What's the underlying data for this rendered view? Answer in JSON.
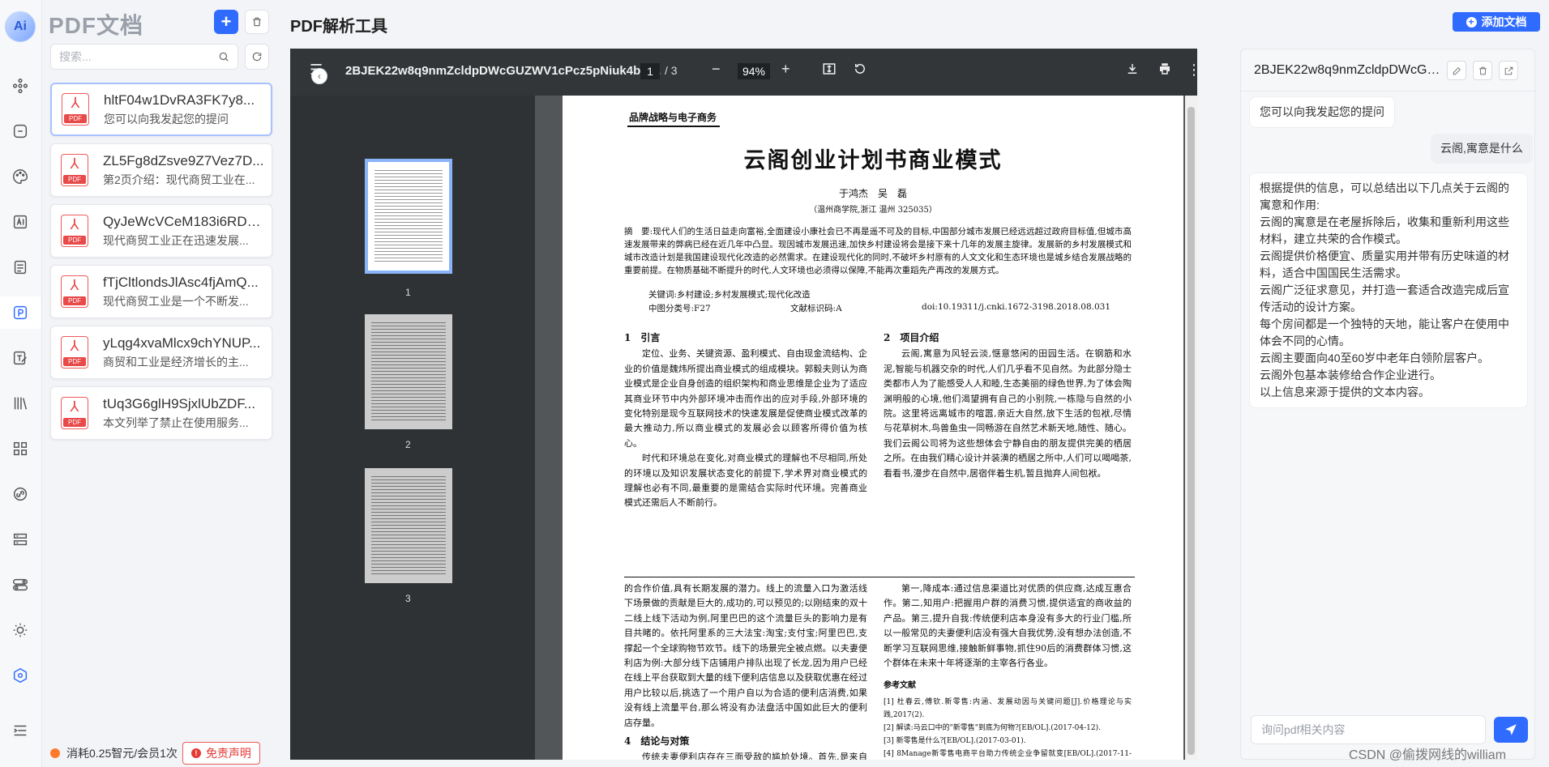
{
  "rail": {
    "logo_text": "Ai"
  },
  "doclist": {
    "title": "PDF文档",
    "search_placeholder": "搜索...",
    "items": [
      {
        "name": "hltF04w1DvRA3FK7y8...",
        "desc": "您可以向我发起您的提问"
      },
      {
        "name": "ZL5Fg8dZsve9Z7Vez7D...",
        "desc": "第2页介绍：现代商贸工业在..."
      },
      {
        "name": "QyJeWcVCeM183i6RD4...",
        "desc": "现代商贸工业正在迅速发展..."
      },
      {
        "name": "fTjCltlondsJlAsc4fjAmQ...",
        "desc": "现代商贸工业是一个不断发..."
      },
      {
        "name": "yLqg4xvaMlcx9chYNUP...",
        "desc": "商贸和工业是经济增长的主..."
      },
      {
        "name": "tUq3G6glH9SjxlUbZDF...",
        "desc": "本文列举了禁止在使用服务..."
      }
    ],
    "footer_text": "消耗0.25智元/会员1次",
    "disclaimer_label": "免责声明",
    "pdf_tag": "PDF"
  },
  "main": {
    "title": "PDF解析工具",
    "add_doc_label": "添加文档"
  },
  "viewer": {
    "file_name": "2BJEK22w8q9nmZcldpDWcGUZWV1cPcz5pNiuk4b4....",
    "page_current": "1",
    "page_total": "/  3",
    "zoom": "94%",
    "thumbnails": [
      "1",
      "2",
      "3"
    ]
  },
  "paper": {
    "section_tag": "品牌战略与电子商务",
    "title": "云阁创业计划书商业模式",
    "authors": "于鸿杰　吴　磊",
    "affiliation": "（温州商学院,浙江 温州 325035）",
    "abstract": "摘　要:现代人们的生活日益走向富裕,全面建设小康社会已不再是遥不可及的目标,中国部分城市发展已经远远超过政府目标值,但城市高速发展带来的弊病已经在近几年中凸显。现因城市发展迅速,加快乡村建设将会是接下来十几年的发展主旋律。发展新的乡村发展模式和城市改造计划是我国建设现代化改造的必然需求。在建设现代化的同时,不破坏乡村原有的人文文化和生态环境也是城乡结合发展战略的重要前提。在物质基础不断提升的时代,人文环境也必须得以保障,不能再次重蹈先产再改的发展方式。",
    "keywords": "关键词:乡村建设;乡村发展模式;现代化改造",
    "class_no": "中图分类号:F27",
    "doc_code": "文献标识码:A",
    "doi": "doi:10.19311/j.cnki.1672-3198.2018.08.031",
    "s1_title": "1　引言",
    "s1_p1": "定位、业务、关键资源、盈利模式、自由现金流结构、企业的价值是魏炜所提出商业模式的组成模块。郭毅夫则认为商业模式是企业自身创造的组织架构和商业思维是企业为了适应其商业环节中内外部环境冲击而作出的应对手段,外部环境的变化特别是现今互联网技术的快速发展是促使商业模式改革的最大推动力,所以商业模式的发展必会以顾客所得价值为核心。",
    "s1_p2": "时代和环境总在变化,对商业模式的理解也不尽相同,所处的环境以及知识发展状态变化的前提下,学术界对商业模式的理解也必有不同,最重要的是需结合实际时代环境。完善商业模式还需后人不断前行。",
    "s2_title": "2　项目介绍",
    "s2_p1": "云阁,寓意为风轻云淡,惬意悠闲的田园生活。在钢筋和水泥,智能与机器交杂的时代,人们几乎看不见自然。为此部分隐士类都市人为了能感受人人和睦,生态美丽的绿色世界,为了体会陶渊明般的心境,他们渴望拥有自己的小别院,一栋隐与自然的小院。这里将远离城市的喧嚣,亲近大自然,放下生活的包袱,尽情与花草树木,鸟兽鱼虫一同畅游在自然艺术新天地,随性、随心。我们云阁公司将为这些想体会宁静自由的朋友提供完美的栖居之所。在由我们精心设计并装潢的栖居之所中,人们可以喝喝茶,看看书,漫步在自然中,居宿伴着生机,暂且抛弃人间包袱。",
    "b_left": "的合作价值,具有长期发展的潜力。线上的流量入口为激活线下场景做的贡献是巨大的,成功的,可以预见的;以刚结束的双十二线上线下活动为例,阿里巴巴的这个流量巨头的影响力是有目共睹的。依托阿里系的三大法宝:淘宝;支付宝;阿里巴巴,支撑起一个全球购物节欢节。线下的场景完全被点燃。以夫妻便利店为例:大部分线下店铺用户排队出现了长龙,因为用户已经在线上平台获取到大量的线下便利店信息以及获取优惠在经过用户比较以后,挑选了一个用户自以为合适的便利店消费,如果没有线上流量平台,那么将没有办法盘活中国如此巨大的便利店存量。",
    "s4_title": "4　结论与对策",
    "s4_p1": "传统夫妻便利店存在三面受敌的尴尬处境。首先,是来自于自我的淘汰,意识和行动和快速更新的互联网时代不匹配。其次,来自同行的冲击,品牌便利店",
    "b_right": "第一,降成本:通过信息渠道比对优质的供应商,达成互惠合作。第二,知用户:把握用户群的消费习惯,提供适宜的商收益的产品。第三,提升自我:传统便利店本身没有多大的行业门槛,所以一般常见的夫妻便利店没有强大自我优势,没有想办法创造,不断学习互联网思维,接触新鲜事物,抓住90后的消费群体习惯,这个群体在未来十年将逐渐的主宰各行各业。",
    "refs_title": "参考文献",
    "refs": [
      "[1] 杜春云,傅钦.新零售:内涵、发展动因与关键问题[J].价格理论与实践,2017(2).",
      "[2] 解读:马云口中的\"新零售\"到底为何物?[EB/OL].(2017-04-12).",
      "[3] 新零售是什么?[EB/OL].(2017-03-01).",
      "[4] 8Manage新零售电商平台助力传统企业争留就变[EB/OL].(2017-11-16)."
    ]
  },
  "chat": {
    "doc_name": "2BJEK22w8q9nmZcldpDWcGUZWV1cPcz5pNiuk4b4",
    "greeting": "您可以向我发起您的提问",
    "user_msg": "云阁,寓意是什么",
    "answer": [
      "根据提供的信息，可以总结出以下几点关于云阁的寓意和作用:",
      "云阁的寓意是在老屋拆除后，收集和重新利用这些材料，建立共荣的合作模式。",
      "云阁提供价格便宜、质量实用并带有历史味道的材料，适合中国国民生活需求。",
      "云阁广泛征求意见，并打造一套适合改造完成后宣传活动的设计方案。",
      "每个房间都是一个独特的天地，能让客户在使用中体会不同的心情。",
      "云阁主要面向40至60岁中老年白领阶层客户。",
      "云阁外包基本装修给合作企业进行。",
      "以上信息来源于提供的文本内容。"
    ],
    "input_placeholder": "询问pdf相关内容"
  },
  "watermark": "CSDN @偷拨网线的william",
  "colors": {
    "accent": "#2f6bff",
    "danger": "#e53935",
    "viewer_bg": "#525659",
    "toolbar_bg": "#323639"
  }
}
